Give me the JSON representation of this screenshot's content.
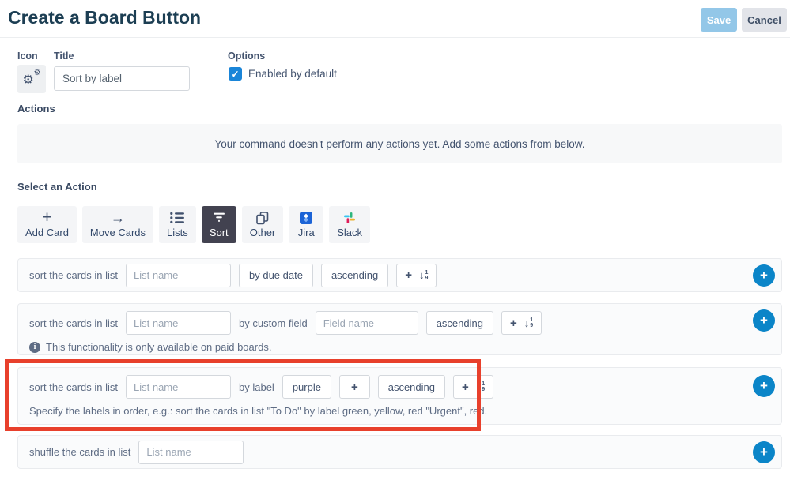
{
  "header": {
    "title": "Create a Board Button",
    "save_label": "Save",
    "cancel_label": "Cancel"
  },
  "form": {
    "icon_label": "Icon",
    "title_label": "Title",
    "title_value": "Sort by label",
    "options_label": "Options",
    "enabled_label": "Enabled by default",
    "enabled_checked": true
  },
  "actions": {
    "label": "Actions",
    "empty_message": "Your command doesn't perform any actions yet. Add some actions from below."
  },
  "action_picker": {
    "label": "Select an Action",
    "tabs": [
      {
        "label": "Add Card",
        "icon": "plus-icon",
        "selected": false
      },
      {
        "label": "Move Cards",
        "icon": "arrow-right-icon",
        "selected": false
      },
      {
        "label": "Lists",
        "icon": "list-icon",
        "selected": false
      },
      {
        "label": "Sort",
        "icon": "filter-icon",
        "selected": true
      },
      {
        "label": "Other",
        "icon": "copy-icon",
        "selected": false
      },
      {
        "label": "Jira",
        "icon": "jira-icon",
        "selected": false
      },
      {
        "label": "Slack",
        "icon": "slack-icon",
        "selected": false
      }
    ]
  },
  "action_rows": {
    "sort_by_due_date": {
      "lead_text": "sort the cards in list",
      "list_placeholder": "List name",
      "sort_field": "by due date",
      "order": "ascending"
    },
    "sort_by_custom_field": {
      "lead_text": "sort the cards in list",
      "list_placeholder": "List name",
      "by_text": "by custom field",
      "field_placeholder": "Field name",
      "order": "ascending",
      "note": "This functionality is only available on paid boards."
    },
    "sort_by_label": {
      "lead_text": "sort the cards in list",
      "list_placeholder": "List name",
      "by_text": "by label",
      "label_value": "purple",
      "order": "ascending",
      "note": "Specify the labels in order, e.g.: sort the cards in list \"To Do\" by label green, yellow, red \"Urgent\", red."
    },
    "shuffle": {
      "lead_text": "shuffle the cards in list",
      "list_placeholder": "List name"
    }
  },
  "icons": {
    "gear": "⚙",
    "plus": "+",
    "arrow_right": "→",
    "check": "✓",
    "info": "i",
    "arrow_down": "↓",
    "sort_digit_top": "1",
    "sort_digit_bottom": "9"
  },
  "colors": {
    "accent_blue": "#0b85c8",
    "checkbox_blue": "#1a85d8",
    "save_bg": "#93c7e8",
    "selected_tab_bg": "#424250",
    "highlight_red": "#e8402c"
  }
}
